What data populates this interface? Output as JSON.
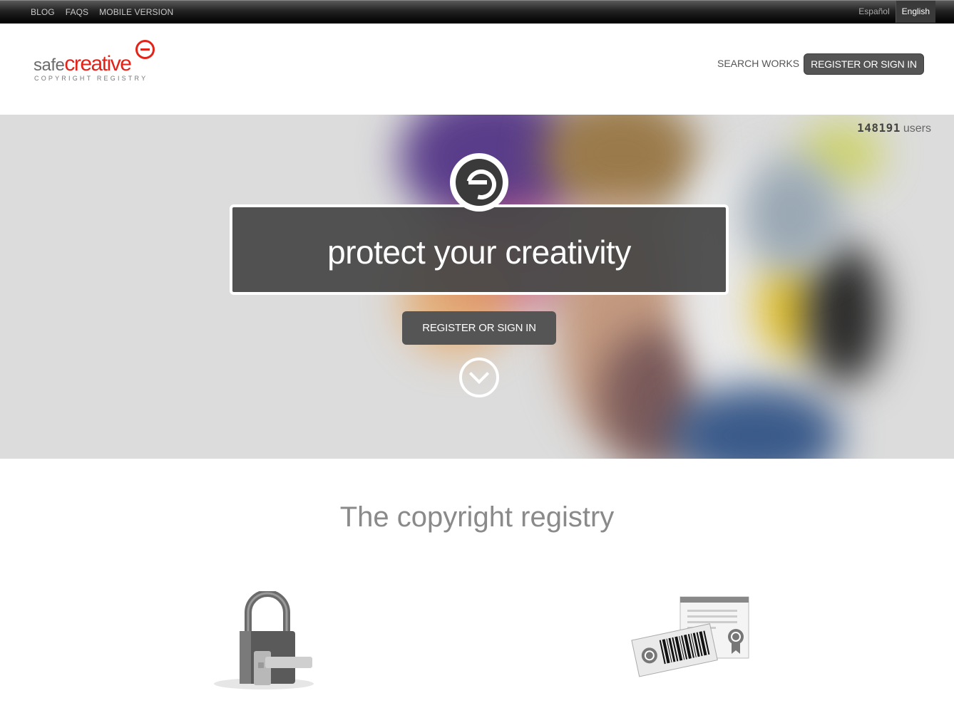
{
  "topbar": {
    "links": [
      "BLOG",
      "FAQS",
      "MOBILE VERSION"
    ],
    "languages": [
      "Español",
      "English"
    ],
    "active_language": "English"
  },
  "header": {
    "logo": {
      "safe": "safe",
      "creative": "creative",
      "tagline": "COPYRIGHT REGISTRY"
    },
    "search_label": "SEARCH WORKS",
    "register_label": "REGISTER OR SIGN IN"
  },
  "hero": {
    "user_count": "148191",
    "users_label": "users",
    "headline": "protect your creativity",
    "button_label": "REGISTER OR SIGN IN"
  },
  "section": {
    "title": "The copyright registry"
  },
  "colors": {
    "brand_red": "#e2231a",
    "button_gray": "#555555",
    "hero_box": "#464646"
  }
}
